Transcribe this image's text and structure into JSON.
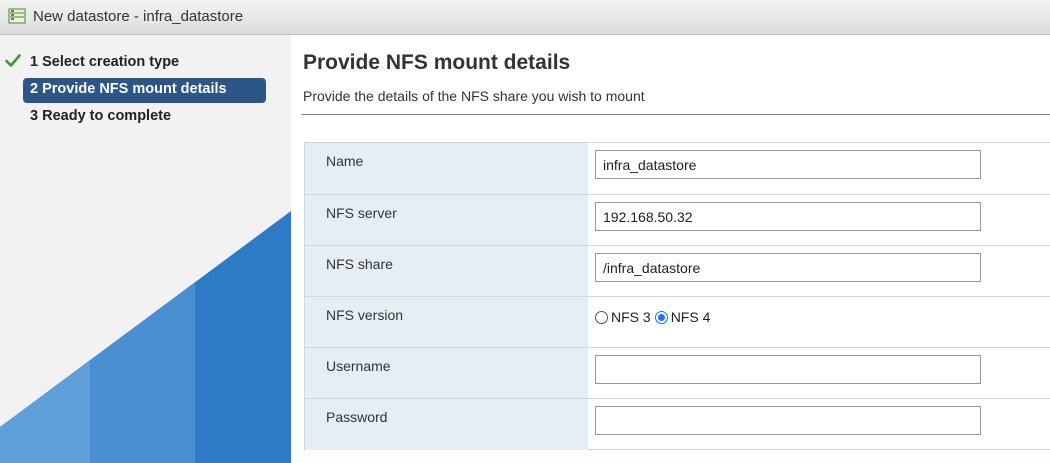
{
  "window": {
    "title": "New datastore - infra_datastore",
    "icon": "datastore-icon"
  },
  "steps": [
    {
      "number": "1",
      "label": "Select creation type",
      "state": "completed"
    },
    {
      "number": "2",
      "label": "Provide NFS mount details",
      "state": "active"
    },
    {
      "number": "3",
      "label": "Ready to complete",
      "state": "pending"
    }
  ],
  "page": {
    "heading": "Provide NFS mount details",
    "subheading": "Provide the details of the NFS share you wish to mount"
  },
  "form": {
    "name": {
      "label": "Name",
      "value": "infra_datastore"
    },
    "server": {
      "label": "NFS server",
      "value": "192.168.50.32"
    },
    "share": {
      "label": "NFS share",
      "value": "/infra_datastore"
    },
    "version": {
      "label": "NFS version",
      "options": [
        "NFS 3",
        "NFS 4"
      ],
      "selected": "NFS 4"
    },
    "username": {
      "label": "Username",
      "value": ""
    },
    "password": {
      "label": "Password",
      "value": ""
    }
  },
  "colors": {
    "active_step_bg": "#2b5686",
    "accent_blue": "#2e7bc5",
    "check_green": "#3a9a2c",
    "label_cell_bg": "#e5eef5"
  }
}
